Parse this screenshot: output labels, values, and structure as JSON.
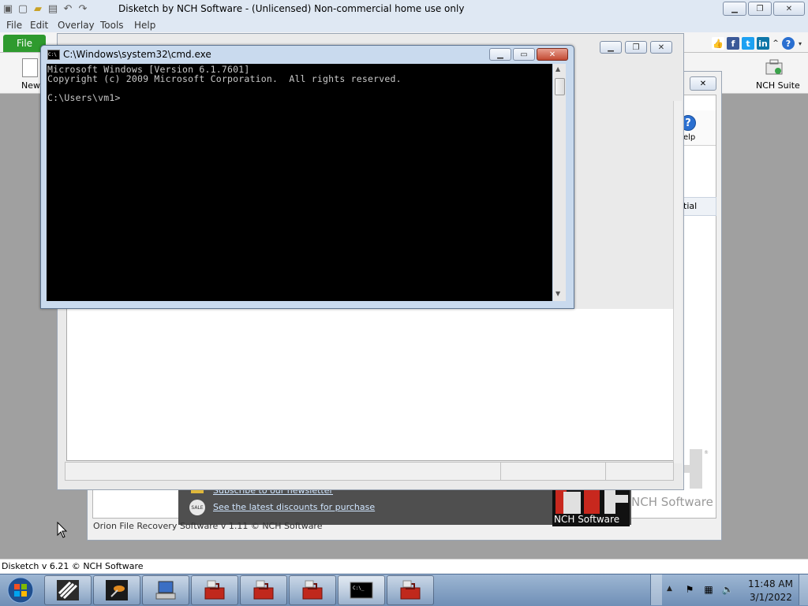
{
  "app": {
    "title": "Disketch by NCH Software - (Unlicensed) Non-commercial home use only",
    "menus": [
      "File",
      "Edit",
      "Overlay",
      "Tools",
      "Help"
    ],
    "file_tab": "File",
    "new_label": "New",
    "nch_suite_label": "NCH Suite",
    "status": "Disketch v 6.21 © NCH Software"
  },
  "social": [
    "like-icon",
    "facebook-icon",
    "twitter-icon",
    "linkedin-icon"
  ],
  "background_dialog": {
    "help_label": "elp",
    "column_header": "tial",
    "promo_newsletter": "Subscribe to our newsletter",
    "promo_discounts": "See the latest discounts for purchase",
    "sale_badge": "SALE",
    "nch_software": "NCH Software",
    "nch_logo_caption": "NCH Software",
    "status": "Orion File Recovery Software v 1.11 © NCH Software"
  },
  "cmd": {
    "title": "C:\\Windows\\system32\\cmd.exe",
    "lines": [
      "Microsoft Windows [Version 6.1.7601]",
      "Copyright (c) 2009 Microsoft Corporation.  All rights reserved.",
      "",
      "C:\\Users\\vm1>"
    ]
  },
  "taskbar": {
    "items": [
      "disketch-icon",
      "telescope-icon",
      "computer-icon",
      "toolbox-icon",
      "toolbox-icon",
      "toolbox-icon",
      "cmd-icon",
      "toolbox-icon"
    ],
    "time": "11:48 AM",
    "date": "3/1/2022"
  }
}
